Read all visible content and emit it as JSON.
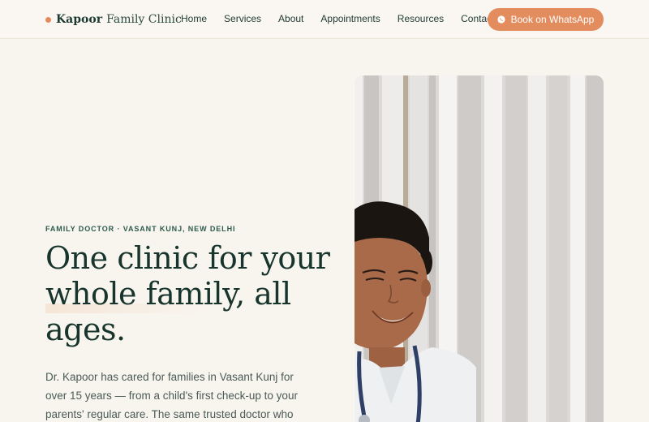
{
  "header": {
    "brand_strong": "Kapoor",
    "brand_light": "Family Clinic",
    "nav": [
      "Home",
      "Services",
      "About",
      "Appointments",
      "Resources",
      "Contact"
    ],
    "cta_label": "Book on WhatsApp",
    "cta_icon": "whatsapp-icon"
  },
  "hero": {
    "eyebrow": "FAMILY DOCTOR · VASANT KUNJ, NEW DELHI",
    "headline": "One clinic for your whole family, all ages.",
    "body": "Dr. Kapoor has cared for families in Vasant Kunj for over 15 years — from a child's first check-up to your parents' regular care. The same trusted doctor who knows your history."
  },
  "colors": {
    "accent": "#e38d5f",
    "ink": "#17352c",
    "background": "#f8f5ef"
  }
}
